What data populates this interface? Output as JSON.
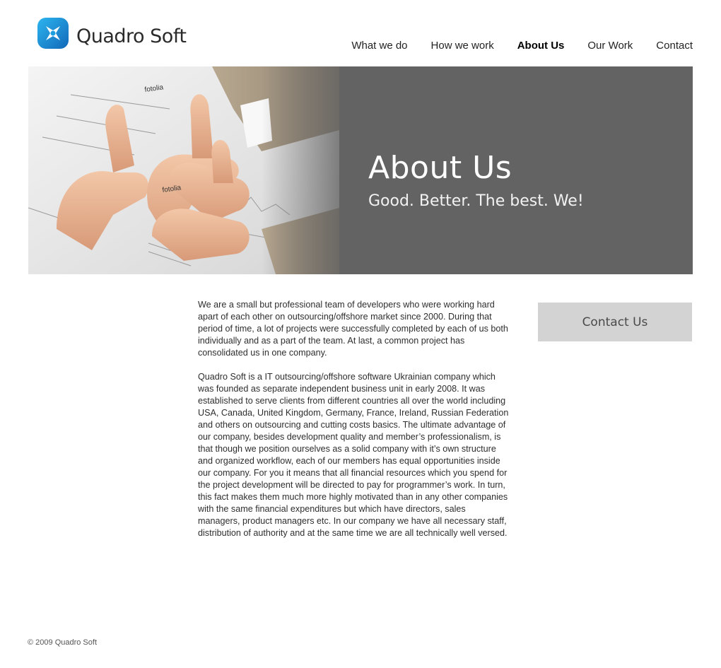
{
  "header": {
    "logo_text": "Quadro Soft",
    "nav": [
      {
        "label": "What we do"
      },
      {
        "label": "How we work"
      },
      {
        "label": "About Us",
        "active": true
      },
      {
        "label": "Our Work"
      },
      {
        "label": "Contact"
      }
    ]
  },
  "banner": {
    "title": "About Us",
    "subtitle": "Good. Better. The best. We!",
    "watermark_1": "fotolia",
    "watermark_2": "fotolia"
  },
  "main": {
    "paragraphs": [
      "We are a small but professional team of developers who were working hard apart of each other on outsourcing/offshore market since 2000. During that period of time, a lot of projects were successfully completed by each of us both individually and as a part of the team. At last, a common project has consolidated us in one company.",
      "Quadro Soft is a IT outsourcing/offshore software Ukrainian company which was founded as separate independent business unit in early 2008. It was established to serve clients from different countries all over the world including USA, Canada, United Kingdom, Germany, France, Ireland, Russian Federation and others on outsourcing and cutting costs basics. The ultimate advantage of our company, besides development quality and member’s professionalism, is that though we position ourselves as a solid company with it’s own structure and organized workflow,  each of our members has equal opportunities inside our company. For you it means that all financial resources which you spend for the project development will be directed to pay for programmer’s work. In turn, this fact makes them much more highly motivated than in any other companies with the same financial expenditures but which have directors, sales managers, product managers etc. In our company we have all necessary staff, distribution of authority and at the same time we are all technically well versed."
    ]
  },
  "sidebar": {
    "contact_button": "Contact Us"
  },
  "footer": {
    "copyright": "© 2009 Quadro Soft"
  },
  "colors": {
    "banner_bg": "#636363",
    "logo_blue": "#1a9fe0",
    "logo_dark_blue": "#1268b8",
    "button_bg": "#d3d3d3"
  }
}
